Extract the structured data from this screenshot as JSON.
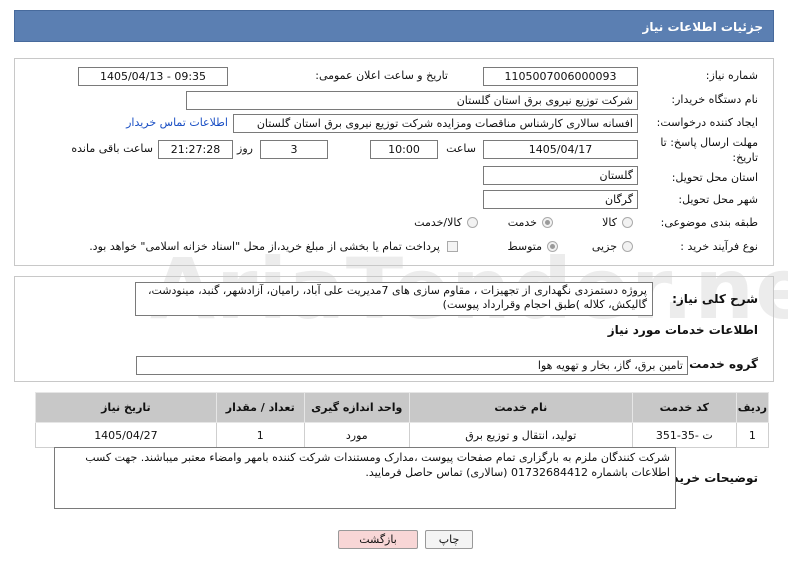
{
  "header": {
    "title": "جزئیات اطلاعات نیاز"
  },
  "form": {
    "need_number_label": "شماره نیاز:",
    "need_number": "1105007006000093",
    "announce_label": "تاریخ و ساعت اعلان عمومی:",
    "announce_value": "1405/04/13 - 09:35",
    "buyer_org_label": "نام دستگاه خریدار:",
    "buyer_org": "شرکت توزیع نیروی برق استان گلستان",
    "creator_label": "ایجاد کننده درخواست:",
    "creator": "افسانه سالاری کارشناس مناقصات ومزایده شرکت توزیع نیروی برق استان گلستان",
    "buyer_contact_link": "اطلاعات تماس خریدار",
    "deadline_label_1": "مهلت ارسال پاسخ: تا",
    "deadline_label_2": "تاریخ:",
    "deadline_date": "1405/04/17",
    "time_label": "ساعت",
    "deadline_time": "10:00",
    "days_value": "3",
    "days_label": "روز و",
    "remaining_time": "21:27:28",
    "remaining_label": "ساعت باقی مانده",
    "province_label": "استان محل تحویل:",
    "province": "گلستان",
    "city_label": "شهر محل تحویل:",
    "city": "گرگان",
    "category_label": "طبقه بندی موضوعی:",
    "category_options": [
      "کالا",
      "خدمت",
      "کالا/خدمت"
    ],
    "purchase_type_label": "نوع فرآیند خرید :",
    "purchase_options": [
      "جزیی",
      "متوسط"
    ],
    "payment_note": "پرداخت تمام یا بخشی از مبلغ خرید،از محل \"اسناد خزانه اسلامی\" خواهد بود."
  },
  "description": {
    "label": "شرح کلی نیاز:",
    "text": "پروژه دستمزدی  نگهداری از تجهیزات ، مقاوم سازی های  7مدیریت علی آباد، رامیان، آزادشهر، گنبد، مینودشت، گالیکش، کلاله )طبق  احجام وقرارداد پیوست)"
  },
  "services": {
    "section_title": "اطلاعات خدمات مورد نیاز",
    "group_label": "گروه خدمت:",
    "group_value": "تامین برق، گاز، بخار و تهویه هوا",
    "columns": [
      "ردیف",
      "کد خدمت",
      "نام خدمت",
      "واحد اندازه گیری",
      "تعداد / مقدار",
      "تاریخ نیاز"
    ],
    "rows": [
      {
        "row": "1",
        "code": "ت -35-351",
        "name": "تولید، انتقال و توزیع برق",
        "unit": "مورد",
        "qty": "1",
        "date": "1405/04/27"
      }
    ]
  },
  "buyer_notes": {
    "label": "توضیحات خریدار:",
    "text": "شرکت کنندگان ملزم به بارگزاری تمام صفحات پیوست ،مدارک ومستندات شرکت کننده بامهر وامضاء معتبر میباشند. جهت کسب اطلاعات باشماره 01732684412 (سالاری) تماس حاصل فرمایید."
  },
  "buttons": {
    "print": "چاپ",
    "back": "بازگشت"
  },
  "watermark": "AriaTender.net",
  "colors": {
    "header": "#5b7fb2",
    "link": "#1a4fc4",
    "back_button": "#f8d6d6"
  }
}
